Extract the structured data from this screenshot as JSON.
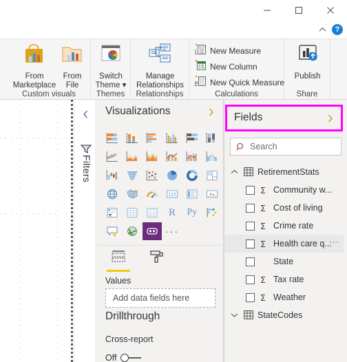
{
  "window": {
    "controls": [
      {
        "name": "minimize",
        "label": "—"
      },
      {
        "name": "maximize",
        "label": "☐"
      },
      {
        "name": "close",
        "label": "✕"
      }
    ],
    "ribbon_collapse_label": "^",
    "help_label": "?"
  },
  "ribbon": {
    "groups": [
      {
        "name": "custom-visuals",
        "label": "Custom visuals",
        "buttons": [
          {
            "name": "from-marketplace",
            "label": "From\nMarketplace",
            "icon": "marketplace-bag-chart-icon"
          },
          {
            "name": "from-file",
            "label": "From\nFile",
            "icon": "folder-chart-icon"
          }
        ]
      },
      {
        "name": "themes",
        "label": "Themes",
        "buttons": [
          {
            "name": "switch-theme",
            "label": "Switch\nTheme ▾",
            "icon": "theme-palette-icon"
          }
        ]
      },
      {
        "name": "relationships",
        "label": "Relationships",
        "buttons": [
          {
            "name": "manage-relationships",
            "label": "Manage\nRelationships",
            "icon": "relationships-icon"
          }
        ]
      },
      {
        "name": "calculations",
        "label": "Calculations",
        "items": [
          {
            "name": "new-measure",
            "label": "New Measure",
            "icon": "new-measure-icon"
          },
          {
            "name": "new-column",
            "label": "New Column",
            "icon": "new-column-icon"
          },
          {
            "name": "new-quick-measure",
            "label": "New Quick Measure",
            "icon": "new-quick-measure-icon"
          }
        ]
      },
      {
        "name": "share",
        "label": "Share",
        "buttons": [
          {
            "name": "publish",
            "label": "Publish",
            "icon": "publish-icon"
          }
        ]
      }
    ]
  },
  "filters_rail": {
    "collapse_label": "‹",
    "icon": "filter-funnel-icon",
    "label": "Filters"
  },
  "visualizations": {
    "title": "Visualizations",
    "expand_label": "›",
    "icons": [
      "stacked-bar-chart",
      "stacked-column-chart",
      "clustered-bar-chart",
      "clustered-column-chart",
      "100-stacked-bar-chart",
      "100-stacked-column-chart",
      "line-chart",
      "area-chart",
      "stacked-area-chart",
      "line-stacked-column-chart",
      "line-clustered-column-chart",
      "ribbon-chart",
      "waterfall-chart",
      "funnel-chart",
      "scatter-chart",
      "pie-chart",
      "donut-chart",
      "treemap-chart",
      "map-visual",
      "filled-map-visual",
      "gauge-visual",
      "card-visual",
      "multi-row-card-visual",
      "kpi-visual",
      "slicer-visual",
      "table-visual",
      "matrix-visual",
      "r-script-visual",
      "python-visual",
      "key-influencers-visual",
      "qna-visual",
      "arcgis-maps-visual",
      "custom-visual-selected",
      "more-options"
    ],
    "selected_icon_index": 32,
    "tabs": [
      {
        "name": "fields-tab",
        "icon": "fields-well-icon",
        "active": true
      },
      {
        "name": "format-tab",
        "icon": "paint-roller-icon",
        "active": false
      }
    ],
    "section_label": "Values",
    "drop_well_placeholder": "Add data fields here",
    "drillthrough_title": "Drillthrough",
    "cross_report_label": "Cross-report",
    "cross_report_toggle_state": "Off"
  },
  "fields": {
    "title": "Fields",
    "expand_label": "›",
    "search": {
      "placeholder": "Search",
      "value": "",
      "icon": "search-icon"
    },
    "tables": [
      {
        "name": "RetirementStats",
        "expanded": true,
        "chevron": "∧",
        "icon": "table-icon",
        "fields": [
          {
            "label": "Community w...",
            "aggregate": "Σ",
            "checked": false,
            "hovered": false,
            "has_more": false
          },
          {
            "label": "Cost of living",
            "aggregate": "Σ",
            "checked": false,
            "hovered": false,
            "has_more": false
          },
          {
            "label": "Crime rate",
            "aggregate": "Σ",
            "checked": false,
            "hovered": false,
            "has_more": false
          },
          {
            "label": "Health care q...",
            "aggregate": "Σ",
            "checked": false,
            "hovered": true,
            "has_more": true,
            "more_label": "···"
          },
          {
            "label": "State",
            "aggregate": "",
            "checked": false,
            "hovered": false,
            "has_more": false
          },
          {
            "label": "Tax rate",
            "aggregate": "Σ",
            "checked": false,
            "hovered": false,
            "has_more": false
          },
          {
            "label": "Weather",
            "aggregate": "Σ",
            "checked": false,
            "hovered": false,
            "has_more": false
          }
        ]
      },
      {
        "name": "StateCodes",
        "expanded": false,
        "chevron": "∨",
        "icon": "table-icon",
        "fields": []
      }
    ]
  },
  "colors": {
    "highlight": "#ff00ff",
    "accent_yellow": "#f2c811",
    "pane_bg": "#f3f2f1",
    "ribbon_bg": "#f5f5f5",
    "selected_visual": "#6b2d7b",
    "help_blue": "#1a7fd4"
  }
}
